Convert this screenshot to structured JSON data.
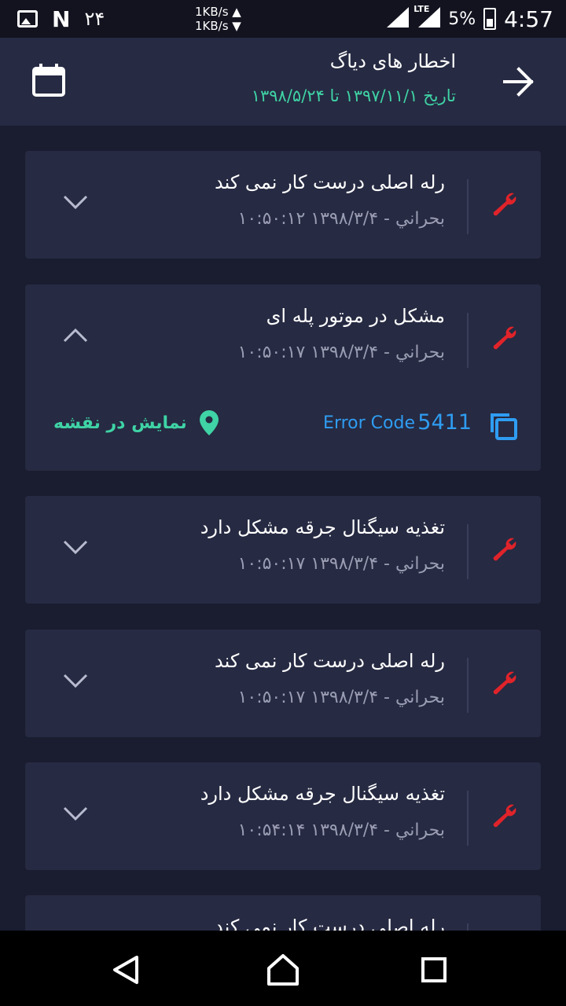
{
  "status_bar": {
    "left_number": "۲۴",
    "n_glyph": "N",
    "speed_up": "1KB/s ▲",
    "speed_down": "1KB/s ▼",
    "network": "LTE",
    "battery": "5%",
    "time": "4:57"
  },
  "header": {
    "title": "اخطار های دیاگ",
    "date_range": "تاریخ ۱۳۹۷/۱۱/۱ تا ۱۳۹۸/۵/۲۴"
  },
  "alerts": [
    {
      "title": "رله اصلی درست کار نمی کند",
      "meta": "بحراني - ۱۳۹۸/۳/۴ ۱۰:۵۰:۱۲",
      "expanded": false
    },
    {
      "title": "مشکل در موتور پله ای",
      "meta": "بحراني - ۱۳۹۸/۳/۴ ۱۰:۵۰:۱۷",
      "expanded": true,
      "error_label": "Error Code",
      "error_code": "5411",
      "map_label": "نمایش در نقشه"
    },
    {
      "title": "تغذیه سیگنال جرقه مشکل دارد",
      "meta": "بحراني - ۱۳۹۸/۳/۴ ۱۰:۵۰:۱۷",
      "expanded": false
    },
    {
      "title": "رله اصلی درست کار نمی کند",
      "meta": "بحراني - ۱۳۹۸/۳/۴ ۱۰:۵۰:۱۷",
      "expanded": false
    },
    {
      "title": "تغذیه سیگنال جرقه مشکل دارد",
      "meta": "بحراني - ۱۳۹۸/۳/۴ ۱۰:۵۴:۱۴",
      "expanded": false
    },
    {
      "title": "رله اصلی درست کار نمی کند",
      "meta": "",
      "expanded": false
    }
  ],
  "colors": {
    "background": "#1a1d30",
    "card": "#262a42",
    "accent_green": "#3fd3a5",
    "accent_blue": "#2f9df2",
    "wrench_red": "#e0232a"
  },
  "icons": {
    "back": "arrow-right-icon",
    "calendar": "calendar-icon",
    "wrench": "wrench-icon",
    "chevron_down": "chevron-down-icon",
    "chevron_up": "chevron-up-icon",
    "copy": "copy-icon",
    "pin": "map-pin-icon"
  }
}
